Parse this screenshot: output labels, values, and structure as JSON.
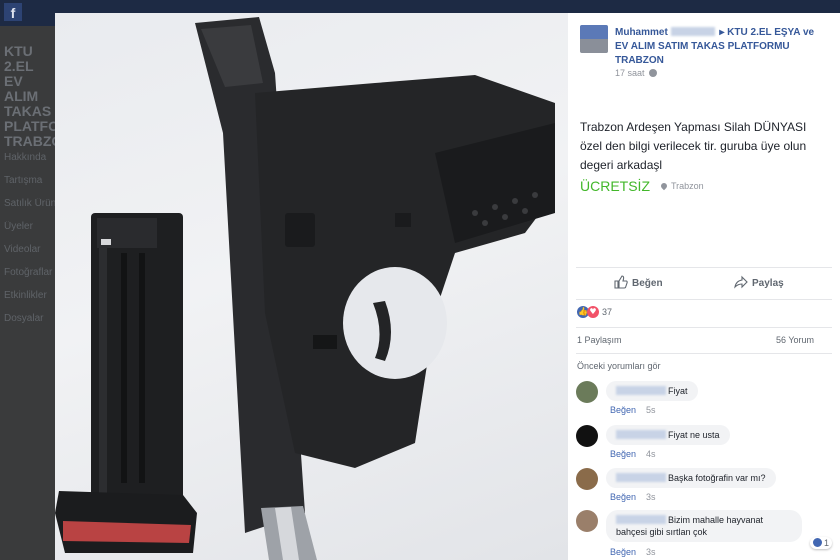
{
  "background": {
    "logo": "f",
    "title_lines": [
      "KTU 2.EL",
      "EV ALIM",
      "TAKAS",
      "PLATFOR",
      "TRABZO"
    ],
    "sidebar_items": [
      "Hakkında",
      "Tartışma",
      "Satılık Ürün",
      "Üyeler",
      "Videolar",
      "Fotoğraflar",
      "Etkinlikler",
      "Dosyalar"
    ]
  },
  "post": {
    "author": "Muhammet",
    "group": "KTU 2.EL EŞYA ve EV ALIM SATIM TAKAS PLATFORMU TRABZON",
    "separator": "▸",
    "time": "17 saat",
    "body": "Trabzon Ardeşen Yapması Silah DÜNYASI özel den bilgi verilecek tir. guruba üye olun degeri arkadaşl",
    "price": "ÜCRETSİZ",
    "location": "Trabzon"
  },
  "actions": {
    "like": "Beğen",
    "share": "Paylaş"
  },
  "stats": {
    "reaction_count": "37",
    "shares": "1 Paylaşım",
    "comments": "56 Yorum",
    "previous_comments": "Önceki yorumları gör"
  },
  "comments": [
    {
      "text": "Fiyat",
      "like": "Beğen",
      "time": "5s",
      "avatar_color": "#6b7b5a"
    },
    {
      "text": "Fiyat ne usta",
      "like": "Beğen",
      "time": "4s",
      "avatar_color": "#111111"
    },
    {
      "text": "Başka fotoğrafin var mı?",
      "like": "Beğen",
      "time": "3s",
      "avatar_color": "#8a6b4a"
    },
    {
      "text": "Bizim mahalle hayvanat bahçesi gibi sırtlan çok",
      "like": "Beğen",
      "time": "3s",
      "avatar_color": "#9a7f6a",
      "reactions": "1"
    }
  ],
  "colors": {
    "link": "#365899",
    "price": "#42b72a",
    "like_blue": "#4267b2"
  }
}
